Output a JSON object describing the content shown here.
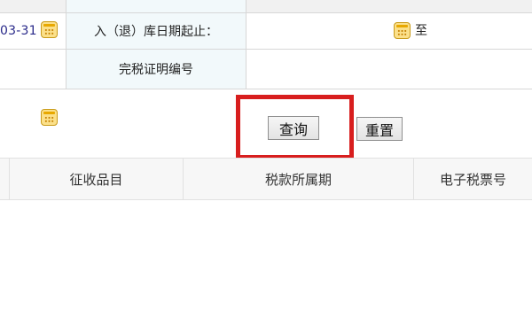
{
  "form": {
    "start_date_partial": "03-31",
    "inbound_date_label": "入（退）库日期起止：",
    "to_label": "至",
    "certificate_label": "完税证明编号",
    "certificate_value": ""
  },
  "buttons": {
    "query": "查询",
    "reset": "重置"
  },
  "table": {
    "headers": [
      "征收品目",
      "税款所属期",
      "电子税票号"
    ]
  },
  "colors": {
    "highlight": "#d81e1e",
    "label_bg": "#f2f9fb"
  }
}
